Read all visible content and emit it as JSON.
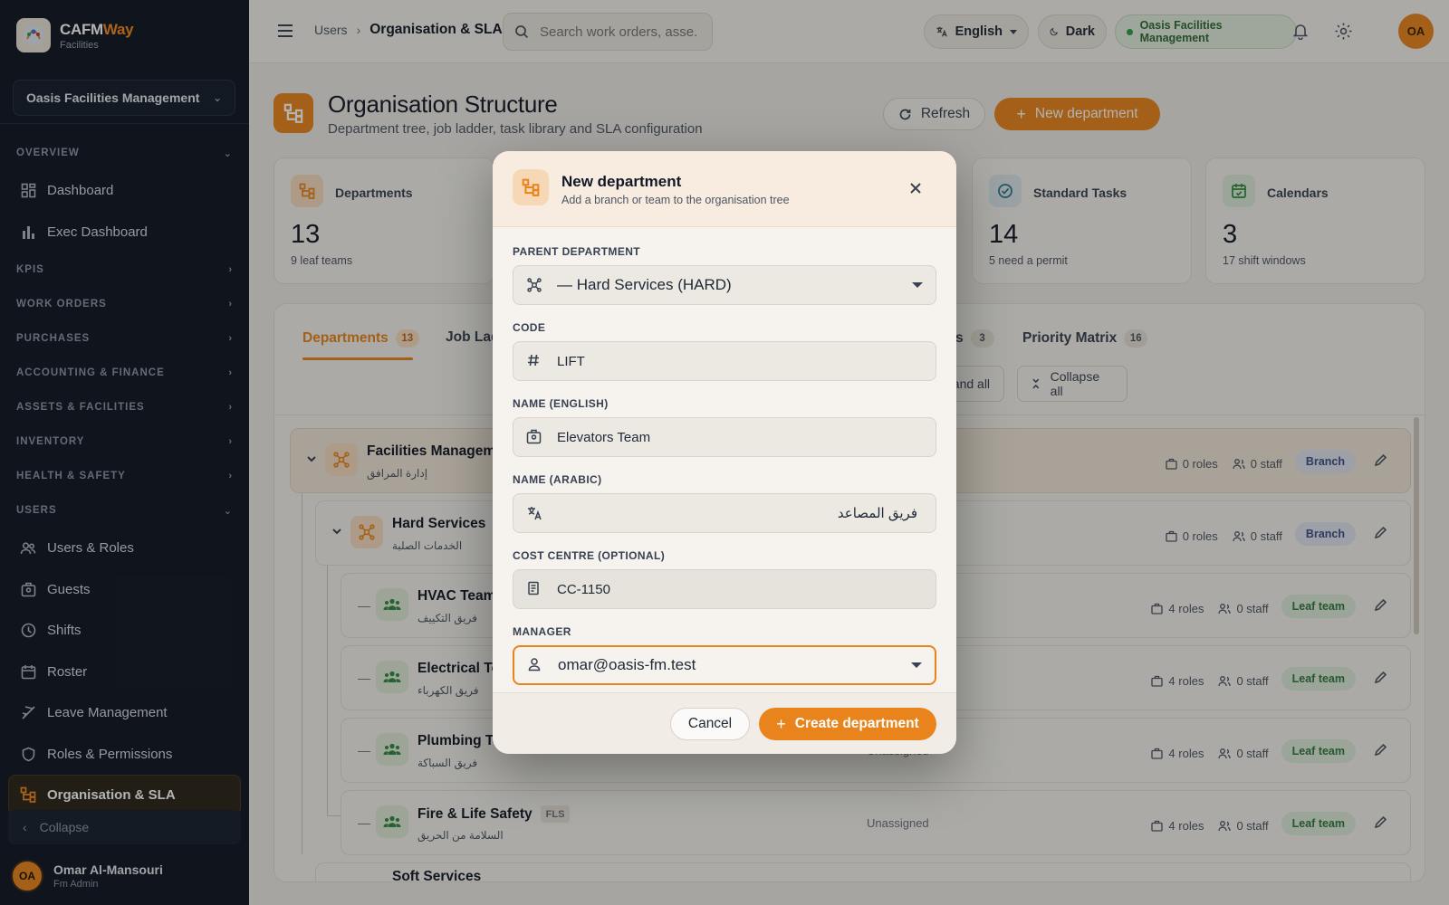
{
  "brand": {
    "name_part1": "CAFM",
    "name_part2": "Way",
    "subtitle": "Facilities"
  },
  "org_selector": {
    "value": "Oasis Facilities Management"
  },
  "nav": {
    "overview": "OVERVIEW",
    "dashboard": "Dashboard",
    "exec_dashboard": "Exec Dashboard",
    "kpis": "KPIS",
    "work_orders": "WORK ORDERS",
    "purchases": "PURCHASES",
    "accounting": "ACCOUNTING & FINANCE",
    "assets": "ASSETS & FACILITIES",
    "inventory": "INVENTORY",
    "health": "HEALTH & SAFETY",
    "users": "USERS",
    "users_roles": "Users & Roles",
    "guests": "Guests",
    "shifts": "Shifts",
    "roster": "Roster",
    "leave": "Leave Management",
    "roles_permissions": "Roles & Permissions",
    "org_sla": "Organisation & SLA",
    "collapse": "Collapse"
  },
  "sidebar_user": {
    "initials": "OA",
    "name": "Omar Al-Mansouri",
    "role": "Fm Admin"
  },
  "topbar": {
    "breadcrumb_parent": "Users",
    "breadcrumb_current": "Organisation & SLA",
    "search_placeholder": "Search work orders, asse...",
    "language": "English",
    "theme": "Dark",
    "org_badge": "Oasis Facilities Management",
    "avatar": "OA"
  },
  "page": {
    "title": "Organisation Structure",
    "subtitle": "Department tree, job ladder, task library and SLA configuration",
    "refresh": "Refresh",
    "new_department": "New department"
  },
  "stats": {
    "departments": {
      "label": "Departments",
      "value": "13",
      "sub": "9 leaf teams"
    },
    "standard_tasks": {
      "label": "Standard Tasks",
      "value": "14",
      "sub": "5 need a permit"
    },
    "calendars": {
      "label": "Calendars",
      "value": "3",
      "sub": "17 shift windows"
    }
  },
  "tabs": {
    "departments": {
      "label": "Departments",
      "count": "13"
    },
    "job_ladder": {
      "label": "Job Lad"
    },
    "partial": {
      "label": "s",
      "count": "3"
    },
    "priority_matrix": {
      "label": "Priority Matrix",
      "count": "16"
    }
  },
  "tools": {
    "expand_all": "pand all",
    "collapse_all": "Collapse all"
  },
  "tree": {
    "root": {
      "name": "Facilities Manageme",
      "ar": "إدارة المرافق",
      "roles": "0 roles",
      "staff": "0 staff",
      "badge": "Branch"
    },
    "hard": {
      "name": "Hard Services",
      "ar": "الخدمات الصلبة",
      "roles": "0 roles",
      "staff": "0 staff",
      "badge": "Branch"
    },
    "hvac": {
      "name": "HVAC Team",
      "ar": "فريق التكييف",
      "roles": "4 roles",
      "staff": "0 staff",
      "badge": "Leaf team"
    },
    "electrical": {
      "name": "Electrical Te",
      "ar": "فريق الكهرباء",
      "roles": "4 roles",
      "staff": "0 staff",
      "badge": "Leaf team"
    },
    "plumbing": {
      "name": "Plumbing Te",
      "ar": "فريق السباكة",
      "manager": "Unassigned",
      "roles": "4 roles",
      "staff": "0 staff",
      "badge": "Leaf team"
    },
    "fire": {
      "name": "Fire & Life Safety",
      "code": "FLS",
      "ar": "السلامة من الحريق",
      "manager": "Unassigned",
      "roles": "4 roles",
      "staff": "0 staff",
      "badge": "Leaf team"
    },
    "soft": {
      "name": "Soft Services"
    }
  },
  "modal": {
    "title": "New department",
    "subtitle": "Add a branch or team to the organisation tree",
    "parent_label": "PARENT DEPARTMENT",
    "parent_value": "— Hard Services (HARD)",
    "code_label": "CODE",
    "code_value": "LIFT",
    "name_en_label": "NAME (ENGLISH)",
    "name_en_value": "Elevators Team",
    "name_ar_label": "NAME (ARABIC)",
    "name_ar_value": "فريق المصاعد",
    "cost_label": "COST CENTRE (OPTIONAL)",
    "cost_value": "CC-1150",
    "manager_label": "MANAGER",
    "manager_value": "omar@oasis-fm.test",
    "cancel": "Cancel",
    "create": "Create department"
  },
  "colors": {
    "accent": "#e9841c",
    "sidebar_bg": "#0f1623",
    "success": "#2f9e44"
  }
}
